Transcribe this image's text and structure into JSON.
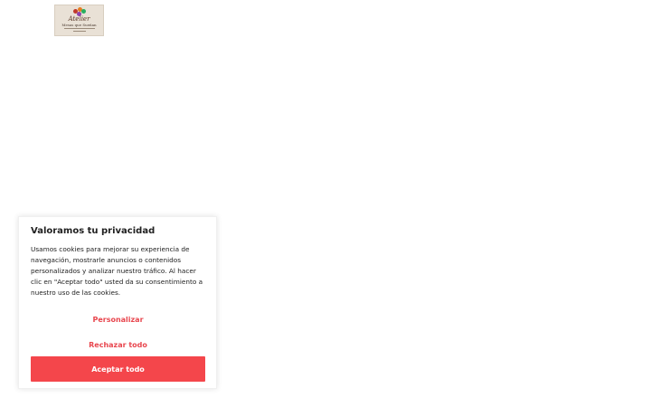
{
  "logo": {
    "name": "Atelier",
    "tagline": "Mesas que Sueñan"
  },
  "cookie_banner": {
    "title": "Valoramos tu privacidad",
    "description": "Usamos cookies para mejorar su experiencia de navegación, mostrarle anuncios o contenidos personalizados y analizar nuestro tráfico. Al hacer clic en \"Aceptar todo\" usted da su consentimiento a nuestro uso de las cookies.",
    "customize_label": "Personalizar",
    "reject_label": "Rechazar todo",
    "accept_label": "Aceptar todo"
  },
  "colors": {
    "accent": "#f4464b",
    "link": "#e8464e",
    "text": "#212121"
  }
}
